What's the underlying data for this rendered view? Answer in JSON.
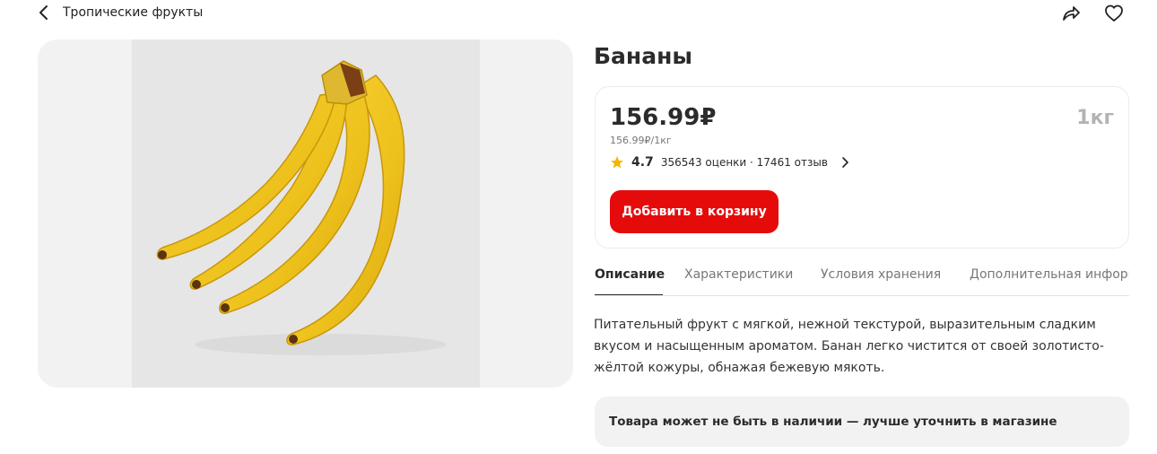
{
  "breadcrumb": {
    "label": "Тропические фрукты"
  },
  "product": {
    "title": "Бананы",
    "image_alt": "Связка бананов"
  },
  "price_card": {
    "price": "156.99₽",
    "unit_price": "156.99₽/1кг",
    "weight": "1кг",
    "rating": "4.7",
    "rating_count": "356543 оценки · 17461 отзыв",
    "add_to_cart": "Добавить в корзину"
  },
  "tabs": [
    {
      "label": "Описание",
      "active": true
    },
    {
      "label": "Характеристики",
      "active": false
    },
    {
      "label": "Условия хранения",
      "active": false
    },
    {
      "label": "Дополнительная информация",
      "active": false
    }
  ],
  "description": "Питательный фрукт с мягкой, нежной текстурой, выразительным сладким вкусом и насыщенным ароматом. Банан легко чистится от своей золотисто-жёлтой кожуры, обнажая бежевую мякоть.",
  "notice": "Товара может не быть в наличии — лучше уточнить в магазине",
  "icons": {
    "back": "chevron-left-icon",
    "share": "share-icon",
    "favorite": "heart-icon",
    "star": "star-icon",
    "more": "chevron-right-icon"
  },
  "colors": {
    "accent": "#e60b0b",
    "star": "#f5b400",
    "muted": "#b3b3b3"
  }
}
